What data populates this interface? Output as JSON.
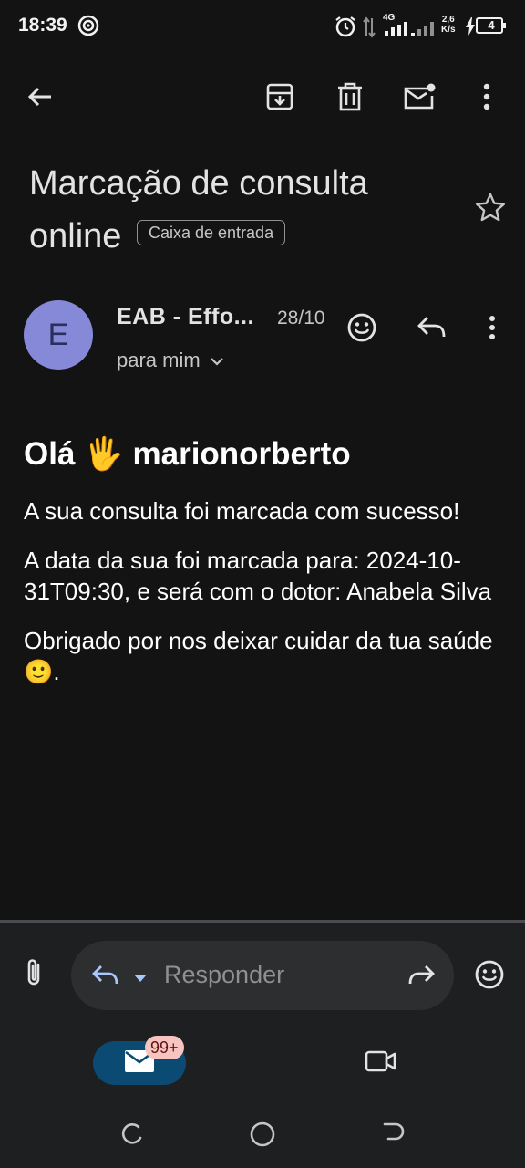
{
  "status_bar": {
    "time": "18:39",
    "network": "4G",
    "speed_value": "2,6",
    "speed_unit": "K/s",
    "battery": "4",
    "icons": [
      "cast-icon",
      "alarm-icon",
      "data-arrows-icon",
      "signal-icon",
      "signal-icon",
      "charging-icon",
      "battery-icon"
    ]
  },
  "toolbar": {
    "icons": [
      "back-arrow-icon",
      "archive-icon",
      "delete-icon",
      "mark-unread-icon",
      "more-vert-icon"
    ]
  },
  "email": {
    "subject": "Marcação de consulta online",
    "label": "Caixa de entrada",
    "sender": {
      "initial": "E",
      "name": "EAB - Effo...",
      "date": "28/10",
      "to": "para mim"
    },
    "greeting": {
      "hello": "Olá",
      "wave": "🖐",
      "name": "marionorberto"
    },
    "paragraphs": [
      "A sua consulta foi marcada com sucesso!",
      "A data da sua foi marcada para: 2024-10-31T09:30, e será com o dotor: Anabela Silva",
      "Obrigado por nos deixar cuidar da tua saúde 🙂."
    ]
  },
  "reply_bar": {
    "placeholder": "Responder"
  },
  "nav": {
    "mail_badge": "99+"
  },
  "colors": {
    "background": "#131314",
    "avatar": "#8589d8",
    "accent_pill": "#0b4a73",
    "badge": "#f8c4c0"
  }
}
